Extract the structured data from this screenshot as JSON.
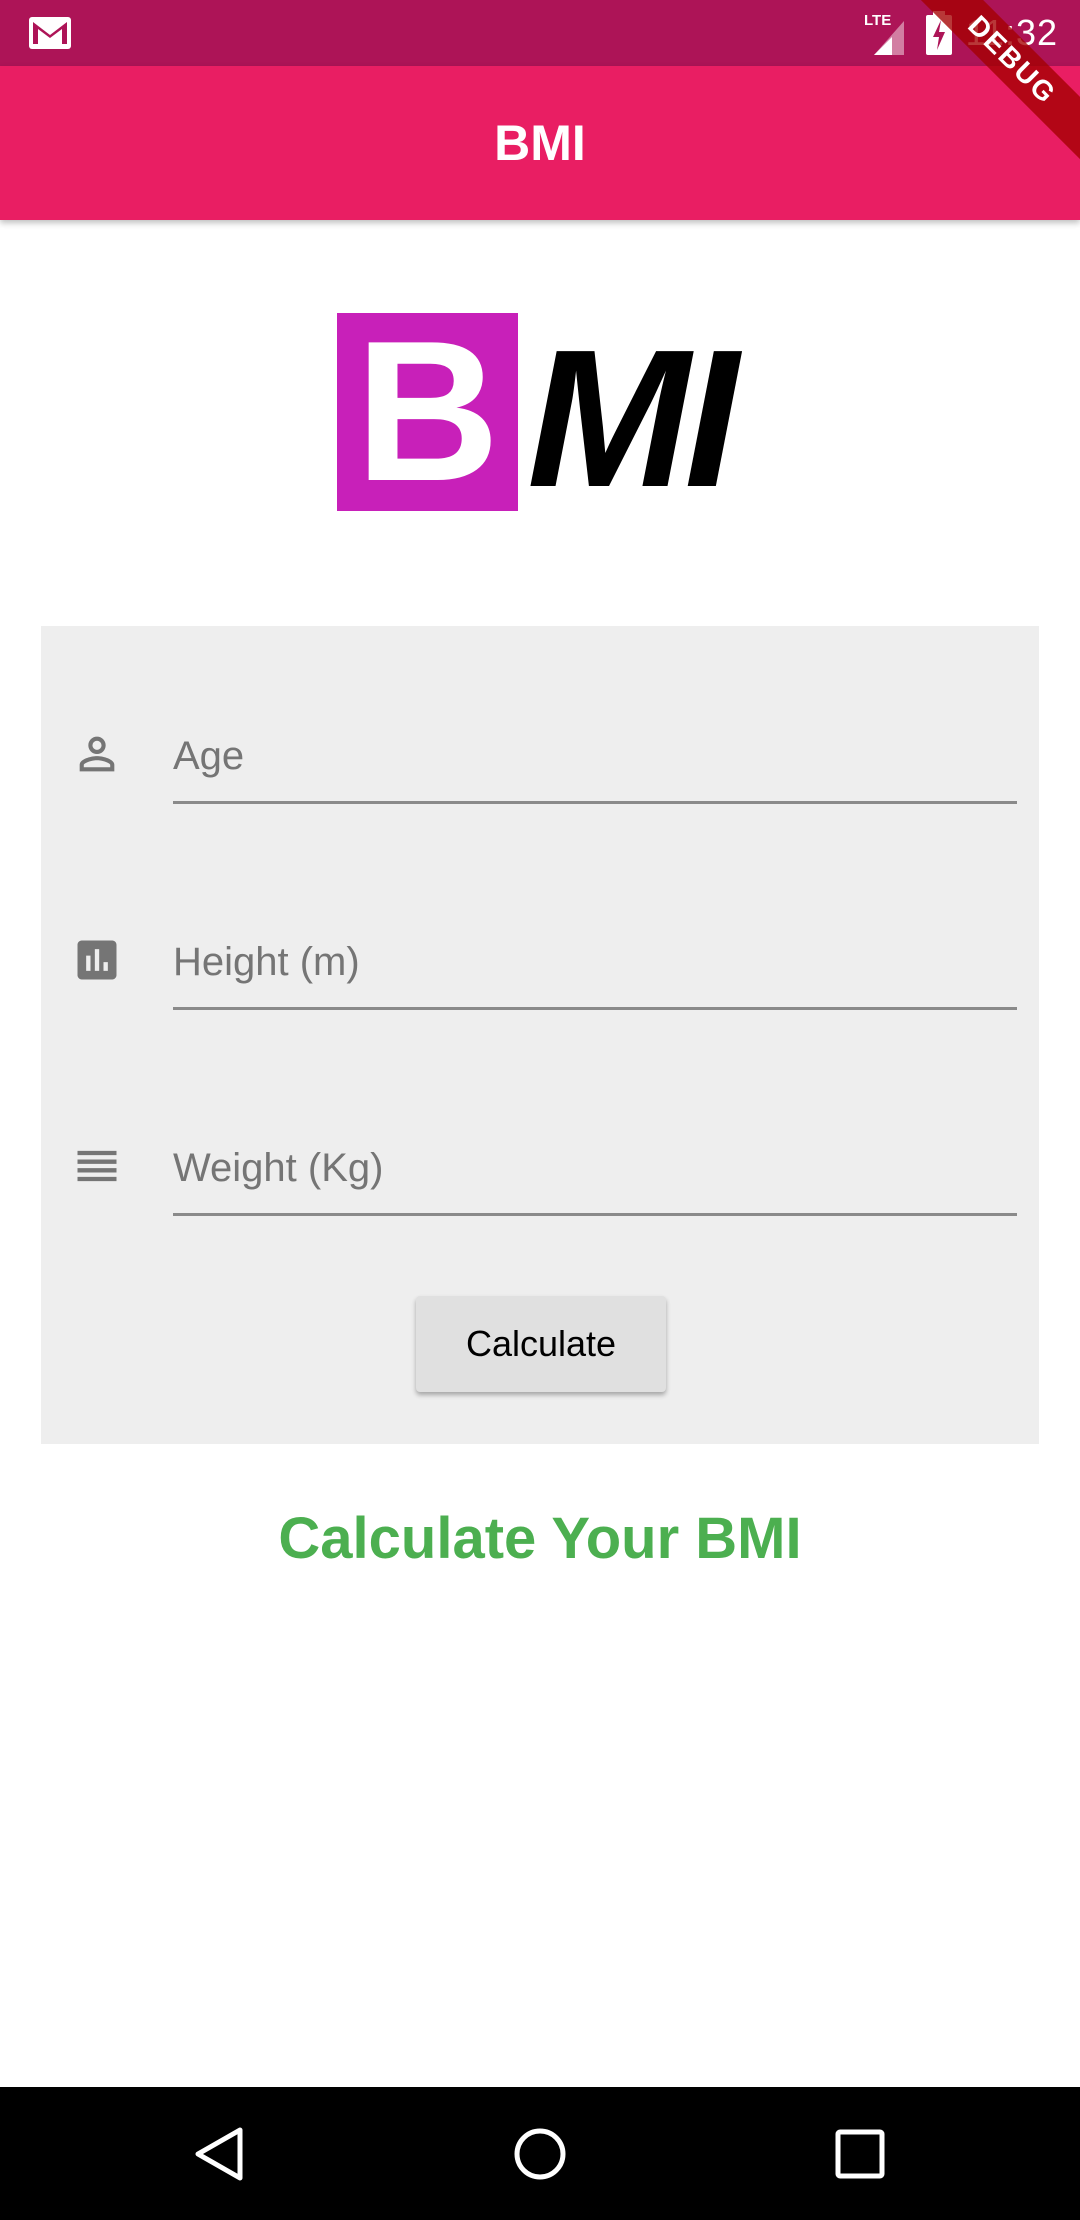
{
  "status_bar": {
    "time": "11:32",
    "network": "LTE",
    "notification_icon": "gmail-icon"
  },
  "debug_banner": "DEBUG",
  "app_bar": {
    "title": "BMI"
  },
  "logo": {
    "letter_b": "B",
    "letters_mi": "MI",
    "colors": {
      "b_box": "#c820b9",
      "mi_text": "#000000"
    }
  },
  "form": {
    "fields": [
      {
        "icon": "person-icon",
        "placeholder": "Age",
        "value": ""
      },
      {
        "icon": "bar-chart-icon",
        "placeholder": "Height (m)",
        "value": ""
      },
      {
        "icon": "lines-icon",
        "placeholder": "Weight (Kg)",
        "value": ""
      }
    ],
    "calculate_label": "Calculate"
  },
  "result": {
    "text": "Calculate Your BMI",
    "color": "#4caf50"
  },
  "theme": {
    "primary": "#e91e63",
    "primary_dark": "#ad1457",
    "card_bg": "#eeeeee"
  },
  "nav_bar": {
    "buttons": [
      "back-icon",
      "home-icon",
      "recents-icon"
    ]
  }
}
